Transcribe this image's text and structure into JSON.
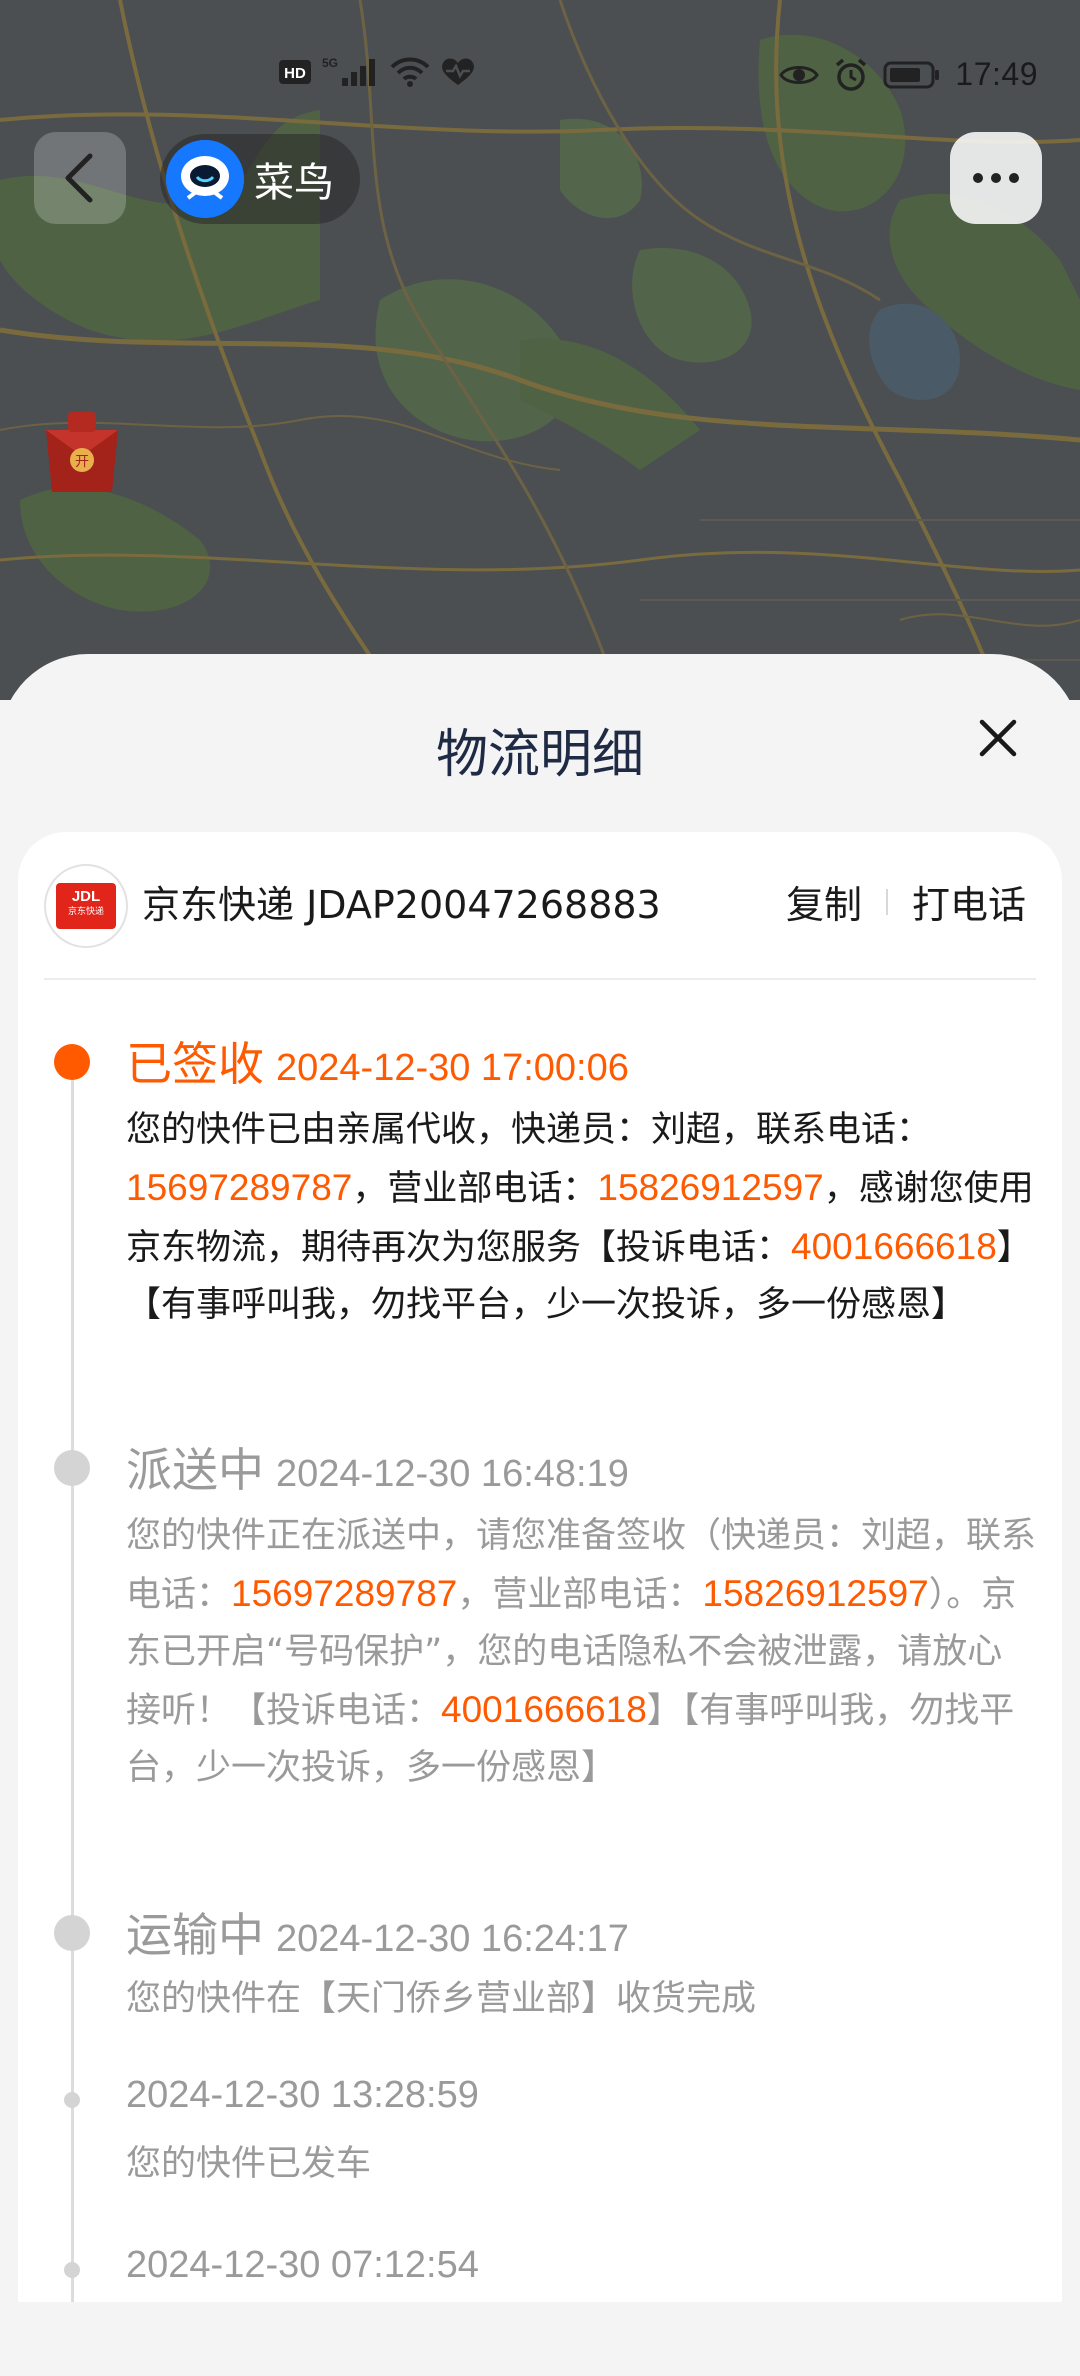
{
  "status_bar": {
    "left_icons": [
      "hd-icon",
      "5g-signal-icon",
      "wifi-icon",
      "heart-pulse-icon"
    ],
    "right_icons": [
      "eye-icon",
      "alarm-icon",
      "battery-icon"
    ],
    "time": "17:49"
  },
  "nav": {
    "app_name": "菜鸟"
  },
  "sheet": {
    "title": "物流明细"
  },
  "carrier": {
    "name_and_number": "京东快递 JDAP20047268883",
    "copy_label": "复制",
    "call_label": "打电话",
    "logo_text": "JDL",
    "logo_sub": "京东快递"
  },
  "events": [
    {
      "status": "已签收",
      "time": "2024-12-30 17:00:06",
      "active": true,
      "body": [
        {
          "t": "您的快件已由亲属代收，快递员：刘超，联系电话："
        },
        {
          "t": "15697289787",
          "phone": true
        },
        {
          "t": "，营业部电话："
        },
        {
          "t": "15826912597",
          "phone": true
        },
        {
          "t": "，感谢您使用京东物流，期待再次为您服务【投诉电话："
        },
        {
          "t": "4001666618",
          "phone": true
        },
        {
          "t": "】【有事呼叫我，勿找平台，少一次投诉，多一份感恩】"
        }
      ]
    },
    {
      "status": "派送中",
      "time": "2024-12-30 16:48:19",
      "active": false,
      "body": [
        {
          "t": "您的快件正在派送中，请您准备签收（快递员：刘超，联系电话："
        },
        {
          "t": "15697289787",
          "phone": true
        },
        {
          "t": "，营业部电话："
        },
        {
          "t": "15826912597",
          "phone": true
        },
        {
          "t": "）。京东已开启“号码保护”，您的电话隐私不会被泄露，请放心接听！【投诉电话："
        },
        {
          "t": "4001666618",
          "phone": true
        },
        {
          "t": "】【有事呼叫我，勿找平台，少一次投诉，多一份感恩】"
        }
      ]
    },
    {
      "status": "运输中",
      "time": "2024-12-30 16:24:17",
      "active": false,
      "body": [
        {
          "t": "您的快件在【天门侨乡营业部】收货完成"
        }
      ]
    },
    {
      "status": "",
      "time": "2024-12-30 13:28:59",
      "active": false,
      "body": [
        {
          "t": "您的快件已发车"
        }
      ]
    },
    {
      "status": "",
      "time": "2024-12-30 07:12:54",
      "active": false,
      "body": []
    }
  ],
  "colors": {
    "accent": "#ff5a00",
    "title": "#1f2a44",
    "muted": "#9a9a9a"
  }
}
